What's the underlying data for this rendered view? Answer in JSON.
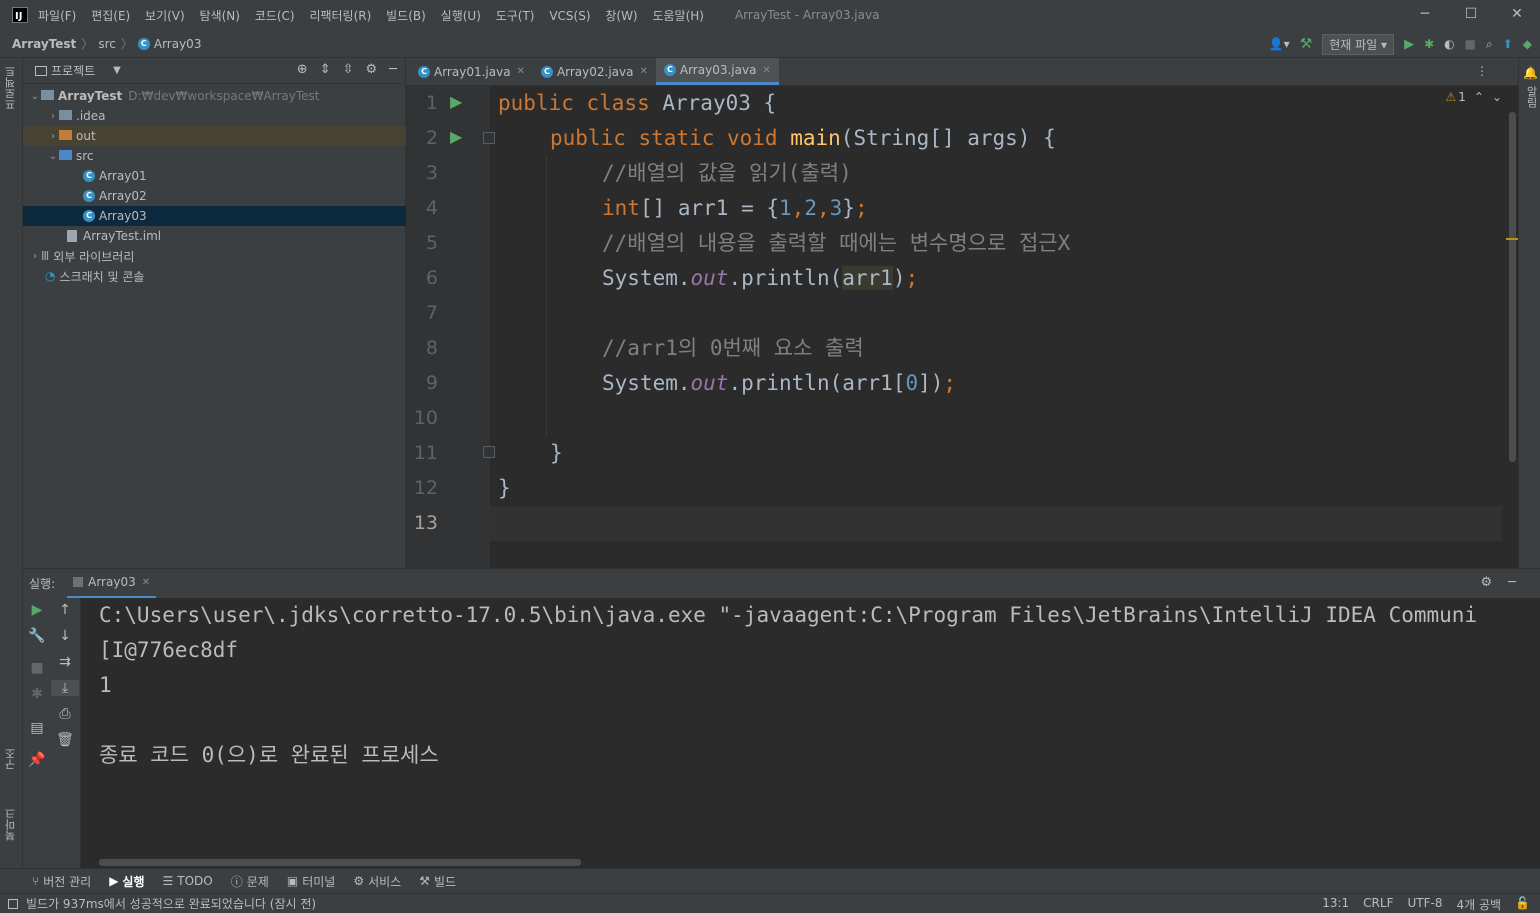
{
  "titlebar": {
    "menu": [
      "파일(F)",
      "편집(E)",
      "보기(V)",
      "탐색(N)",
      "코드(C)",
      "리팩터링(R)",
      "빌드(B)",
      "실행(U)",
      "도구(T)",
      "VCS(S)",
      "창(W)",
      "도움말(H)"
    ],
    "title": "ArrayTest - Array03.java"
  },
  "navbar": {
    "project": "ArrayTest",
    "folder": "src",
    "file": "Array03",
    "run_config": "현재 파일"
  },
  "left_strip": {
    "project": "프로젝트",
    "structure": "구조",
    "bookmarks": "북마크"
  },
  "right_strip": {
    "notifications": "알림"
  },
  "project_panel": {
    "title": "프로젝트",
    "root": {
      "name": "ArrayTest",
      "path": "D:₩dev₩workspace₩ArrayTest"
    },
    "items": [
      ".idea",
      "out",
      "src",
      "Array01",
      "Array02",
      "Array03",
      "ArrayTest.iml",
      "외부 라이브러리",
      "스크래치 및 콘솔"
    ]
  },
  "editor": {
    "tabs": [
      "Array01.java",
      "Array02.java",
      "Array03.java"
    ],
    "active_tab": "Array03.java",
    "warnings": "1",
    "line_numbers": [
      "1",
      "2",
      "3",
      "4",
      "5",
      "6",
      "7",
      "8",
      "9",
      "10",
      "11",
      "12",
      "13"
    ],
    "code": {
      "l1_kw": "public class ",
      "l1_name": "Array03 {",
      "l2_kw": "public static void ",
      "l2_fn": "main",
      "l2_rest": "(String[] args) {",
      "l3": "//배열의 값을 읽기(출력)",
      "l4_kw": "int",
      "l4_a": "[] arr1 = {",
      "l4_n1": "1",
      "l4_c1": ",",
      "l4_n2": "2",
      "l4_c2": ",",
      "l4_n3": "3",
      "l4_b": "}",
      "l4_semi": ";",
      "l5": "//배열의 내용을 출력할 때에는 변수명으로 접근X",
      "l6_a": "System.",
      "l6_out": "out",
      "l6_b": ".println(",
      "l6_var": "arr1",
      "l6_c": ")",
      "l6_semi": ";",
      "l8": "//arr1의 0번째 요소 출력",
      "l9_a": "System.",
      "l9_out": "out",
      "l9_b": ".println(arr1[",
      "l9_n": "0",
      "l9_c": "])",
      "l9_semi": ";",
      "l11": "}",
      "l12": "}"
    }
  },
  "run_panel": {
    "label": "실행:",
    "tab": "Array03",
    "console": [
      "C:\\Users\\user\\.jdks\\corretto-17.0.5\\bin\\java.exe \"-javaagent:C:\\Program Files\\JetBrains\\IntelliJ IDEA Communi",
      "[I@776ec8df",
      "1",
      "",
      "종료 코드 0(으)로 완료된 프로세스"
    ]
  },
  "bottom_tabs": [
    "버전 관리",
    "실행",
    "TODO",
    "문제",
    "터미널",
    "서비스",
    "빌드"
  ],
  "status": {
    "message": "빌드가 937ms에서 성공적으로 완료되었습니다 (잠시 전)",
    "position": "13:1",
    "line_sep": "CRLF",
    "encoding": "UTF-8",
    "indent": "4개 공백"
  },
  "colors": {
    "accent": "#4a88c7",
    "run_green": "#59a869",
    "keyword": "#cc7832",
    "function": "#ffc66d",
    "number": "#6897bb",
    "comment": "#808080"
  }
}
